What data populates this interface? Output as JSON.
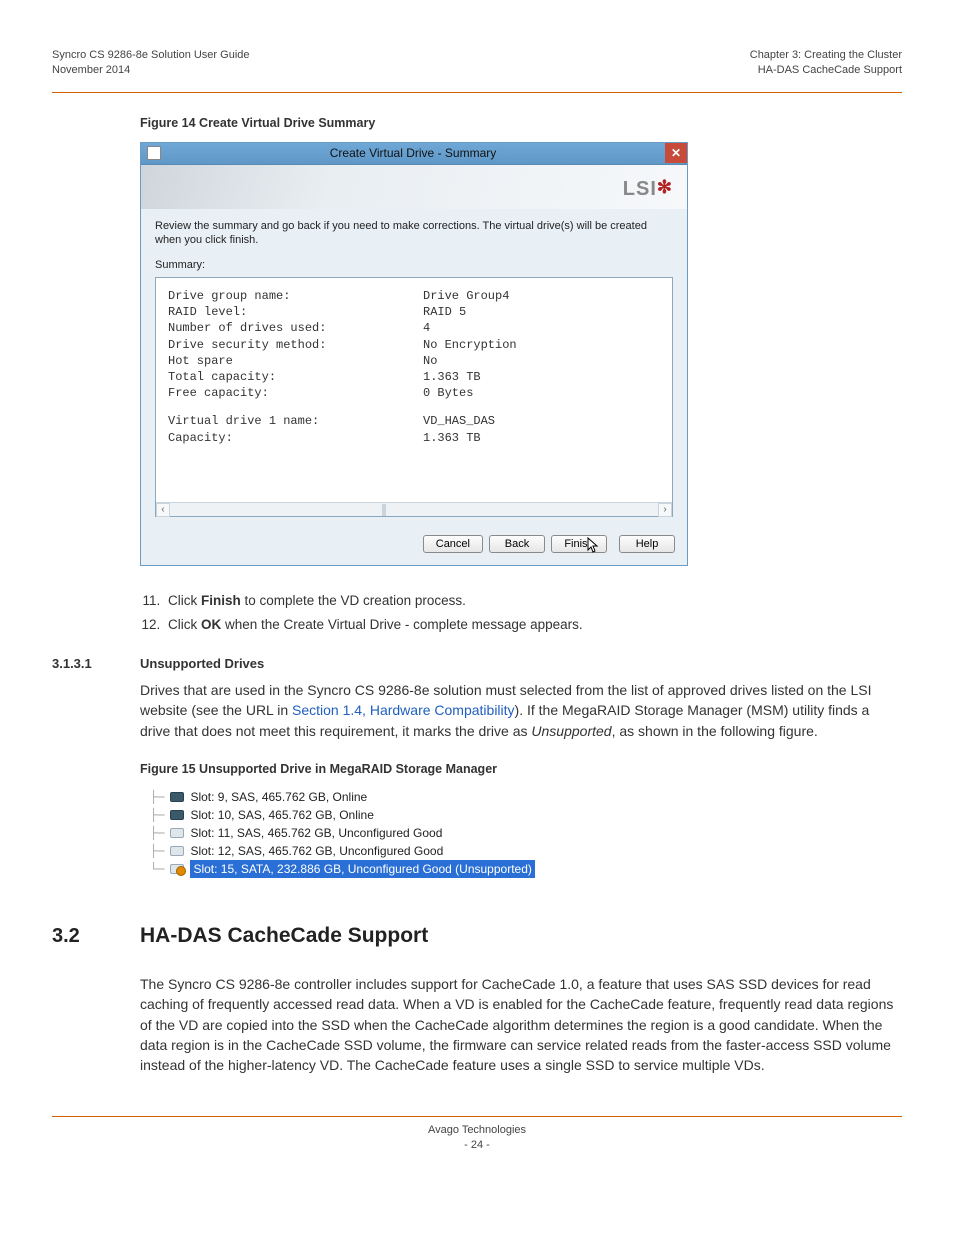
{
  "header": {
    "left_line1": "Syncro CS 9286-8e Solution User Guide",
    "left_line2": "November 2014",
    "right_line1": "Chapter 3: Creating the Cluster",
    "right_line2": "HA-DAS CacheCade Support"
  },
  "figure14": {
    "caption": "Figure 14  Create Virtual Drive Summary",
    "title": "Create Virtual Drive - Summary",
    "close_glyph": "✕",
    "brand": "LSI",
    "instruction": "Review the summary and go back if you need to make corrections. The virtual drive(s) will be created when you click finish.",
    "summary_label": "Summary:",
    "rows": [
      {
        "k": "Drive group name:",
        "v": "Drive Group4"
      },
      {
        "k": "RAID level:",
        "v": "RAID 5"
      },
      {
        "k": "Number of drives used:",
        "v": "4"
      },
      {
        "k": "Drive security method:",
        "v": "No Encryption"
      },
      {
        "k": "Hot spare",
        "v": "No"
      },
      {
        "k": "Total capacity:",
        "v": "1.363 TB"
      },
      {
        "k": "Free capacity:",
        "v": "0 Bytes"
      }
    ],
    "rows2": [
      {
        "k": "Virtual drive 1 name:",
        "v": "VD_HAS_DAS"
      },
      {
        "k": "Capacity:",
        "v": "1.363 TB"
      }
    ],
    "scroll_left": "‹",
    "scroll_right": "›",
    "buttons": {
      "cancel": "Cancel",
      "back": "Back",
      "finish": "Finish",
      "help": "Help"
    }
  },
  "steps": {
    "s11_a": "Click ",
    "s11_bold": "Finish",
    "s11_b": " to complete the VD creation process.",
    "s12_a": "Click ",
    "s12_bold": "OK",
    "s12_b": " when the Create Virtual Drive - complete message appears."
  },
  "section_3_1_3_1": {
    "number": "3.1.3.1",
    "title": "Unsupported Drives",
    "para_a": "Drives that are used in the Syncro CS 9286-8e solution must selected from the list of approved drives listed on the LSI website (see the URL in ",
    "para_link": "Section 1.4, Hardware Compatibility",
    "para_b": "). If the MegaRAID Storage Manager (MSM) utility finds a drive that does not meet this requirement, it marks the drive as ",
    "para_italic": "Unsupported",
    "para_c": ", as shown in the following figure."
  },
  "figure15": {
    "caption": "Figure 15  Unsupported Drive in MegaRAID Storage Manager",
    "drives": [
      {
        "icon": "dark",
        "text": "Slot: 9, SAS, 465.762 GB, Online"
      },
      {
        "icon": "dark",
        "text": "Slot: 10, SAS, 465.762 GB, Online"
      },
      {
        "icon": "light",
        "text": "Slot: 11, SAS, 465.762 GB, Unconfigured Good"
      },
      {
        "icon": "light",
        "text": "Slot: 12, SAS, 465.762 GB, Unconfigured Good"
      },
      {
        "icon": "warn",
        "text": "Slot: 15, SATA, 232.886 GB, Unconfigured Good (Unsupported)",
        "selected": true
      }
    ]
  },
  "section_3_2": {
    "number": "3.2",
    "title": "HA-DAS CacheCade Support",
    "para": "The Syncro CS 9286-8e controller includes support for CacheCade 1.0, a feature that uses SAS SSD devices for read caching of frequently accessed read data. When a VD is enabled for the CacheCade feature, frequently read data regions of the VD are copied into the SSD when the CacheCade algorithm determines the region is a good candidate. When the data region is in the CacheCade SSD volume, the firmware can service related reads from the faster-access SSD volume instead of the higher-latency VD. The CacheCade feature uses a single SSD to service multiple VDs."
  },
  "footer": {
    "company": "Avago Technologies",
    "page": "- 24 -"
  }
}
